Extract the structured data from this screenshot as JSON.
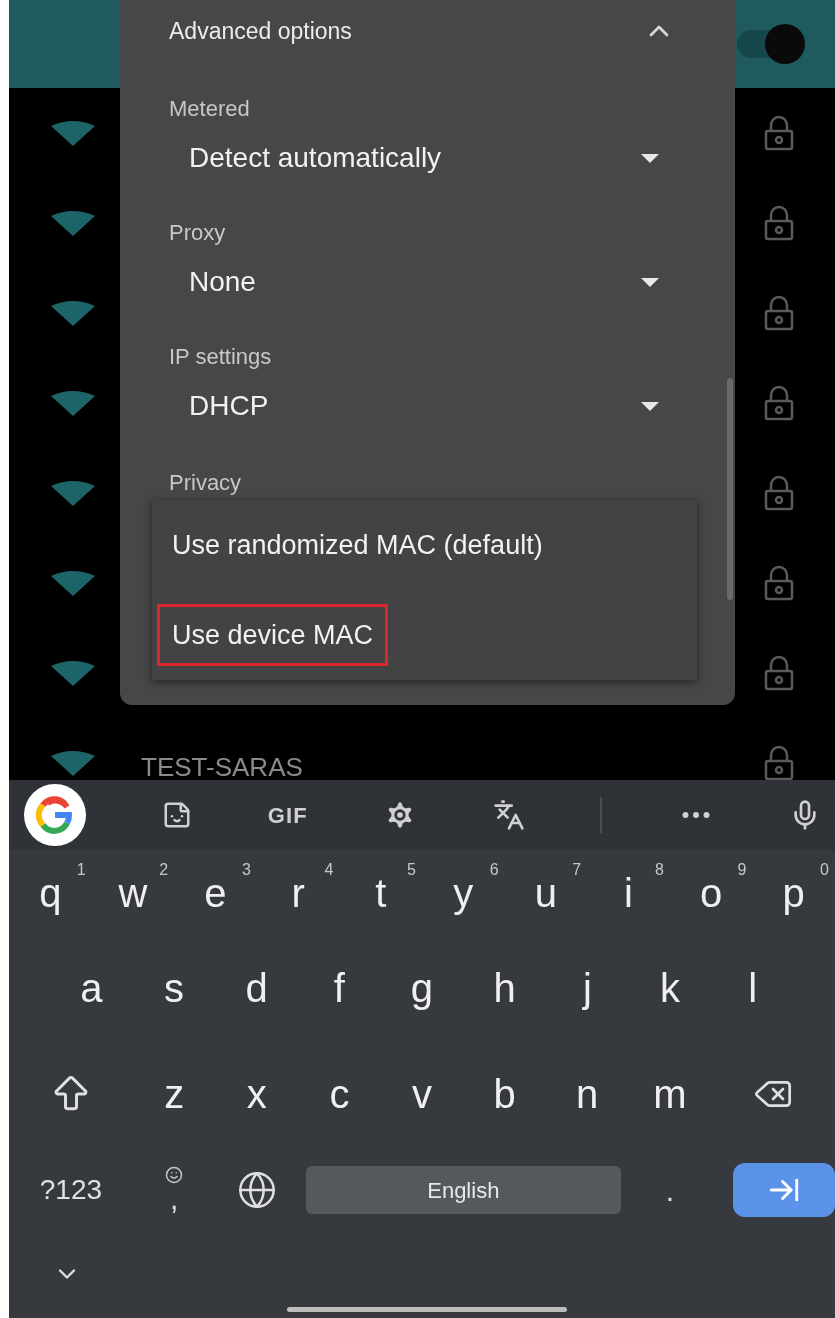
{
  "header": {
    "toggle": {
      "on": true
    }
  },
  "networks": [
    {
      "secured": true
    },
    {
      "secured": true
    },
    {
      "secured": true
    },
    {
      "secured": true
    },
    {
      "secured": true
    },
    {
      "secured": true
    },
    {
      "secured": true
    },
    {
      "name": "TEST-SARAS",
      "secured": true
    }
  ],
  "dialog": {
    "section_title": "Advanced options",
    "expanded": true,
    "fields": [
      {
        "label": "Metered",
        "value": "Detect automatically"
      },
      {
        "label": "Proxy",
        "value": "None"
      },
      {
        "label": "IP settings",
        "value": "DHCP"
      }
    ],
    "privacy": {
      "label": "Privacy",
      "options": [
        {
          "label": "Use randomized MAC (default)",
          "highlighted": false
        },
        {
          "label": "Use device MAC",
          "highlighted": true
        }
      ]
    }
  },
  "keyboard": {
    "toolbar": [
      {
        "kind": "google"
      },
      {
        "kind": "sticker"
      },
      {
        "kind": "text",
        "label": "GIF"
      },
      {
        "kind": "settings"
      },
      {
        "kind": "translate"
      },
      {
        "kind": "divider"
      },
      {
        "kind": "more"
      },
      {
        "kind": "mic"
      }
    ],
    "letter_rows": [
      [
        {
          "kind": "char",
          "label": "q",
          "hint": "1"
        },
        {
          "kind": "char",
          "label": "w",
          "hint": "2"
        },
        {
          "kind": "char",
          "label": "e",
          "hint": "3"
        },
        {
          "kind": "char",
          "label": "r",
          "hint": "4"
        },
        {
          "kind": "char",
          "label": "t",
          "hint": "5"
        },
        {
          "kind": "char",
          "label": "y",
          "hint": "6"
        },
        {
          "kind": "char",
          "label": "u",
          "hint": "7"
        },
        {
          "kind": "char",
          "label": "i",
          "hint": "8"
        },
        {
          "kind": "char",
          "label": "o",
          "hint": "9"
        },
        {
          "kind": "char",
          "label": "p",
          "hint": "0"
        }
      ],
      [
        {
          "kind": "char",
          "label": "a"
        },
        {
          "kind": "char",
          "label": "s"
        },
        {
          "kind": "char",
          "label": "d"
        },
        {
          "kind": "char",
          "label": "f"
        },
        {
          "kind": "char",
          "label": "g"
        },
        {
          "kind": "char",
          "label": "h"
        },
        {
          "kind": "char",
          "label": "j"
        },
        {
          "kind": "char",
          "label": "k"
        },
        {
          "kind": "char",
          "label": "l"
        }
      ],
      [
        {
          "kind": "shift"
        },
        {
          "kind": "char",
          "label": "z"
        },
        {
          "kind": "char",
          "label": "x"
        },
        {
          "kind": "char",
          "label": "c"
        },
        {
          "kind": "char",
          "label": "v"
        },
        {
          "kind": "char",
          "label": "b"
        },
        {
          "kind": "char",
          "label": "n"
        },
        {
          "kind": "char",
          "label": "m"
        },
        {
          "kind": "backspace"
        }
      ]
    ],
    "bottom_row": [
      {
        "kind": "symbols",
        "label": "?123"
      },
      {
        "kind": "emoji",
        "label": ","
      },
      {
        "kind": "globe"
      },
      {
        "kind": "space",
        "label": "English"
      },
      {
        "kind": "period",
        "label": "."
      },
      {
        "kind": "enter"
      }
    ]
  }
}
